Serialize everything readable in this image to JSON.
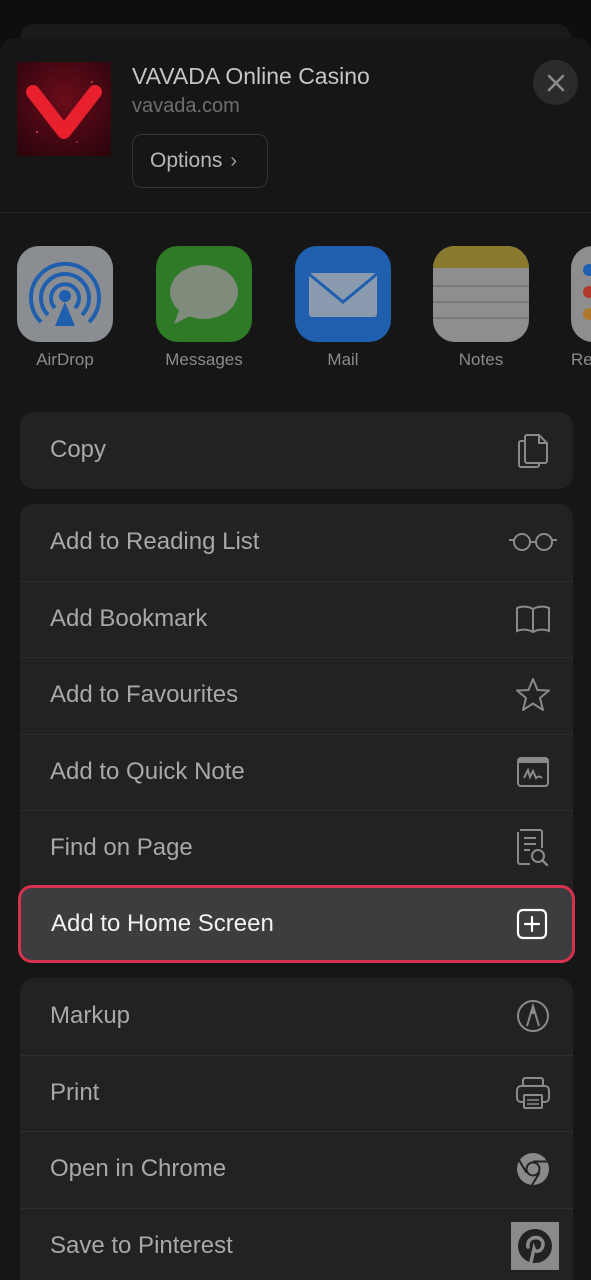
{
  "header": {
    "title": "VAVADA Online Casino",
    "subtitle": "vavada.com",
    "options_label": "Options",
    "options_chevron": "›",
    "close_icon": "close-icon"
  },
  "share_apps": [
    {
      "label": "AirDrop",
      "icon": "airdrop-icon"
    },
    {
      "label": "Messages",
      "icon": "messages-icon"
    },
    {
      "label": "Mail",
      "icon": "mail-icon"
    },
    {
      "label": "Notes",
      "icon": "notes-icon"
    },
    {
      "label": "Re",
      "icon": "reminders-icon"
    }
  ],
  "actions_group1": [
    {
      "label": "Copy",
      "icon": "copy-icon"
    }
  ],
  "actions_group2": [
    {
      "label": "Add to Reading List",
      "icon": "glasses-icon"
    },
    {
      "label": "Add Bookmark",
      "icon": "book-icon"
    },
    {
      "label": "Add to Favourites",
      "icon": "star-icon"
    },
    {
      "label": "Add to Quick Note",
      "icon": "quick-note-icon"
    },
    {
      "label": "Find on Page",
      "icon": "find-on-page-icon"
    },
    {
      "label": "Add to Home Screen",
      "icon": "add-square-icon",
      "highlighted": true
    }
  ],
  "actions_group3": [
    {
      "label": "Markup",
      "icon": "markup-icon"
    },
    {
      "label": "Print",
      "icon": "printer-icon"
    },
    {
      "label": "Open in Chrome",
      "icon": "chrome-icon"
    },
    {
      "label": "Save to Pinterest",
      "icon": "pinterest-icon"
    }
  ],
  "colors": {
    "highlight_border": "#d4324f",
    "sheet_bg": "#161616",
    "group_bg": "#222222"
  }
}
